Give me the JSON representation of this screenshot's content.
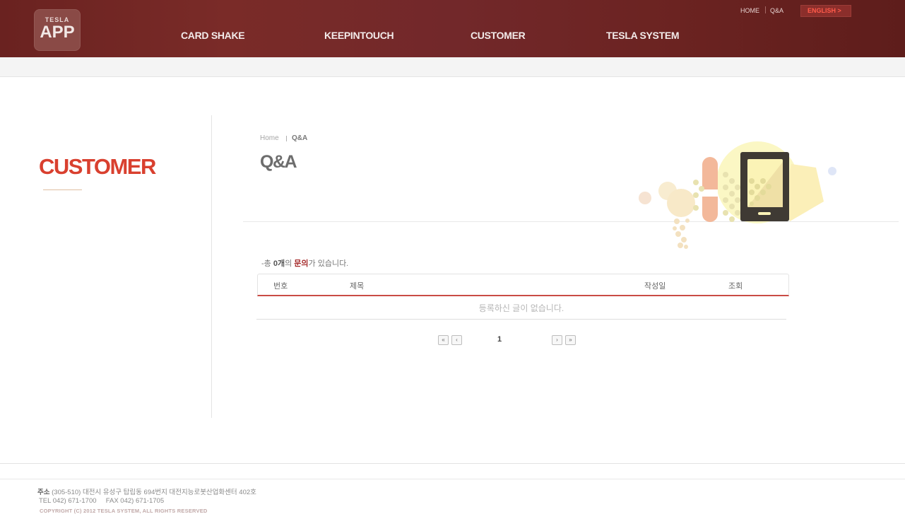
{
  "header": {
    "logo_small": "TESLA",
    "logo_big": "APP",
    "nav": [
      "CARD SHAKE",
      "KEEPINTOUCH",
      "CUSTOMER",
      "TESLA SYSTEM"
    ],
    "util_home": "HOME",
    "util_qa": "Q&A",
    "english": "ENGLISH >"
  },
  "sidebar": {
    "title": "CUSTOMER"
  },
  "breadcrumb": {
    "home": "Home",
    "current": "Q&A"
  },
  "page_title": "Q&A",
  "summary": {
    "prefix": "-총 ",
    "count": "0개",
    "mid": "의 ",
    "highlight": "문의",
    "suffix": "가 있습니다."
  },
  "table": {
    "headers": [
      "번호",
      "제목",
      "작성일",
      "조회"
    ],
    "empty_message": "등록하신 글이 없습니다."
  },
  "pagination": {
    "first": "«",
    "prev": "‹",
    "current_page": "1",
    "next": "›",
    "last": "»"
  },
  "footer": {
    "address_label": "주소",
    "address": "(305-510) 대전시 유성구 탑립동 694번지 대전지능로봇산업화센터 402호",
    "tel": "TEL 042) 671-1700     FAX 042) 671-1705",
    "copyright": "COPYRIGHT (C) 2012 TESLA SYSTEM, ALL RIGHTS RESERVED"
  },
  "colors": {
    "header_bg": "#6a2220",
    "accent_red": "#d9402f",
    "table_line": "#c94c45"
  }
}
